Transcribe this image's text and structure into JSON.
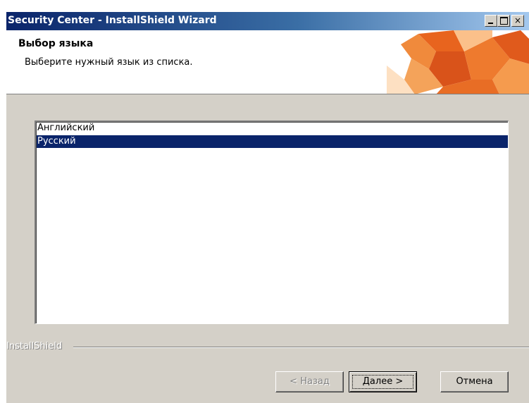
{
  "window": {
    "title": "Security Center - InstallShield Wizard",
    "controls": {
      "minimize": "_",
      "maximize": "□",
      "close": "×"
    }
  },
  "header": {
    "title": "Выбор языка",
    "subtitle": "Выберите нужный язык из списка."
  },
  "language_list": {
    "items": [
      {
        "label": "Английский",
        "selected": false
      },
      {
        "label": "Русский",
        "selected": true
      }
    ]
  },
  "branding": {
    "label": "InstallShield"
  },
  "buttons": {
    "back": "< Назад",
    "next": "Далее >",
    "cancel": "Отмена"
  },
  "colors": {
    "titlebar": "#0a246a",
    "selection": "#0a246a",
    "dialog_bg": "#d4d0c8",
    "header_art": "#e8641e"
  }
}
